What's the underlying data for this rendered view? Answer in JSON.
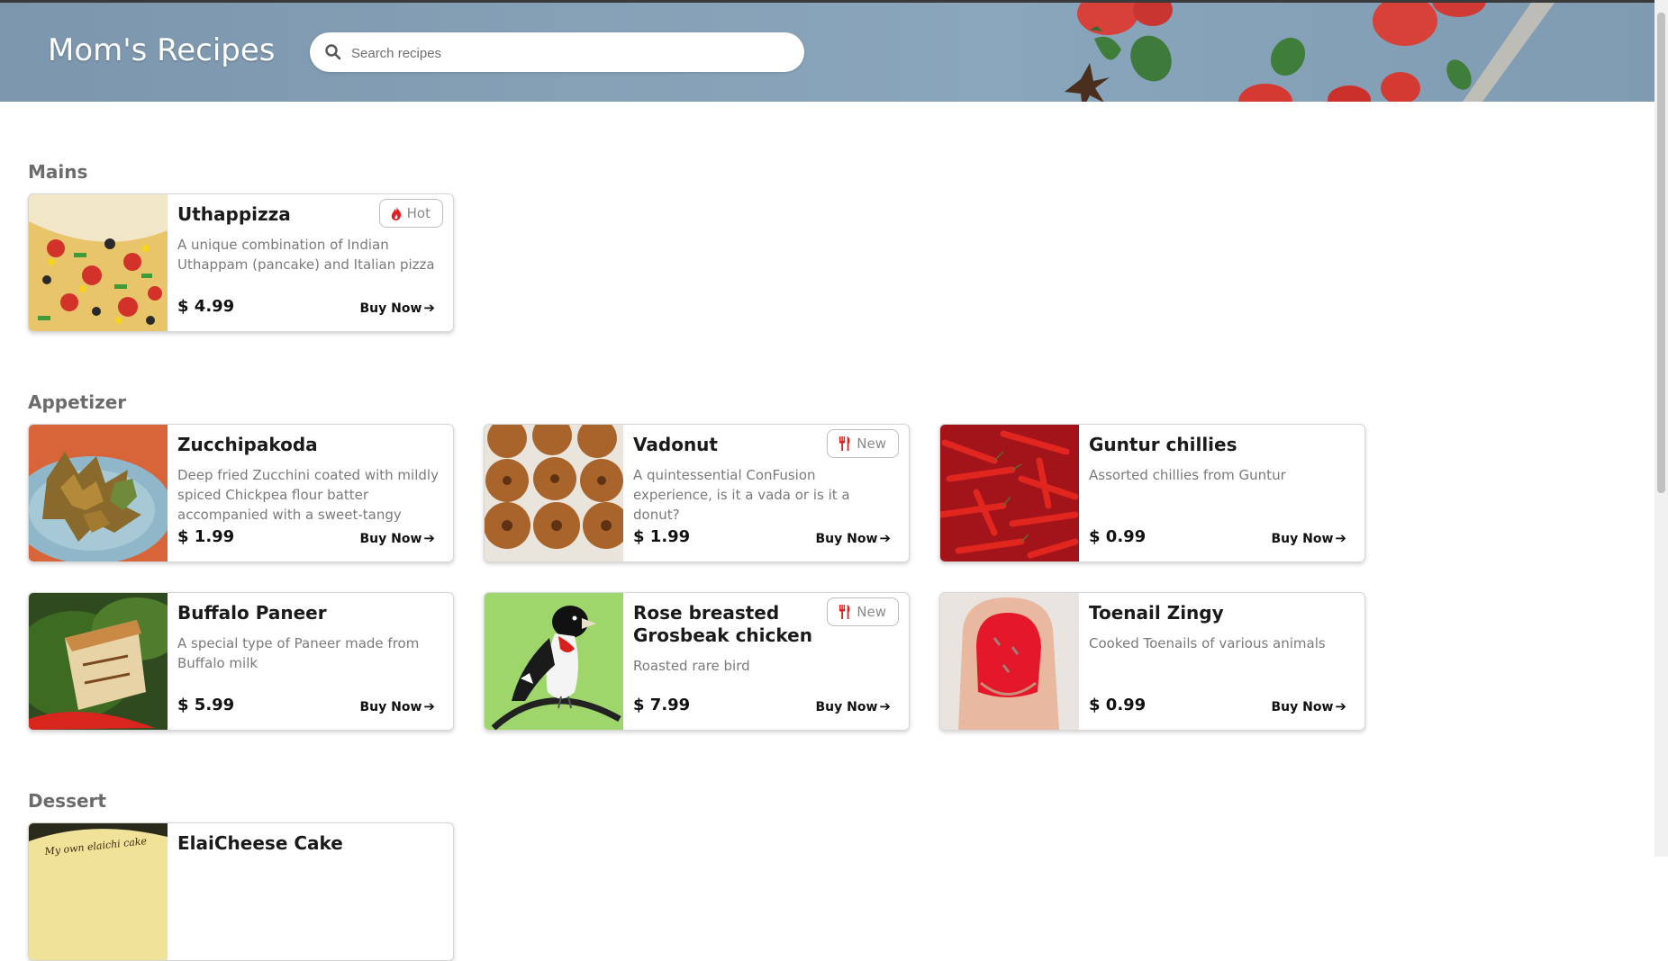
{
  "app": {
    "title": "Mom's Recipes"
  },
  "search": {
    "placeholder": "Search recipes",
    "value": ""
  },
  "colors": {
    "badge_icon": "#e02020",
    "text_dark": "#111111",
    "text_muted": "#7a7a7a",
    "section_title": "#6b6b6b"
  },
  "sections": [
    {
      "title": "Mains",
      "items": [
        {
          "name": "Uthappizza",
          "description": "A unique combination of Indian Uthappam (pancake) and Italian pizza",
          "price": "$ 4.99",
          "action": "Buy Now",
          "badge": {
            "label": "Hot",
            "icon": "flame-icon"
          }
        }
      ]
    },
    {
      "title": "Appetizer",
      "items": [
        {
          "name": "Zucchipakoda",
          "description": "Deep fried Zucchini coated with mildly spiced Chickpea flour batter accompanied with a sweet-tangy",
          "price": "$ 1.99",
          "action": "Buy Now"
        },
        {
          "name": "Vadonut",
          "description": "A quintessential ConFusion experience, is it a vada or is it a donut?",
          "price": "$ 1.99",
          "action": "Buy Now",
          "badge": {
            "label": "New",
            "icon": "cutlery-icon"
          }
        },
        {
          "name": "Guntur chillies",
          "description": "Assorted chillies from Guntur",
          "price": "$ 0.99",
          "action": "Buy Now"
        },
        {
          "name": "Buffalo Paneer",
          "description": "A special type of Paneer made from Buffalo milk",
          "price": "$ 5.99",
          "action": "Buy Now"
        },
        {
          "name": "Rose breasted Grosbeak chicken",
          "description": "Roasted rare bird",
          "price": "$ 7.99",
          "action": "Buy Now",
          "badge": {
            "label": "New",
            "icon": "cutlery-icon"
          }
        },
        {
          "name": "Toenail Zingy",
          "description": "Cooked Toenails of various animals",
          "price": "$ 0.99",
          "action": "Buy Now"
        }
      ]
    },
    {
      "title": "Dessert",
      "items": [
        {
          "name": "ElaiCheese Cake",
          "image_text": "My own elaichi cake"
        }
      ]
    }
  ]
}
